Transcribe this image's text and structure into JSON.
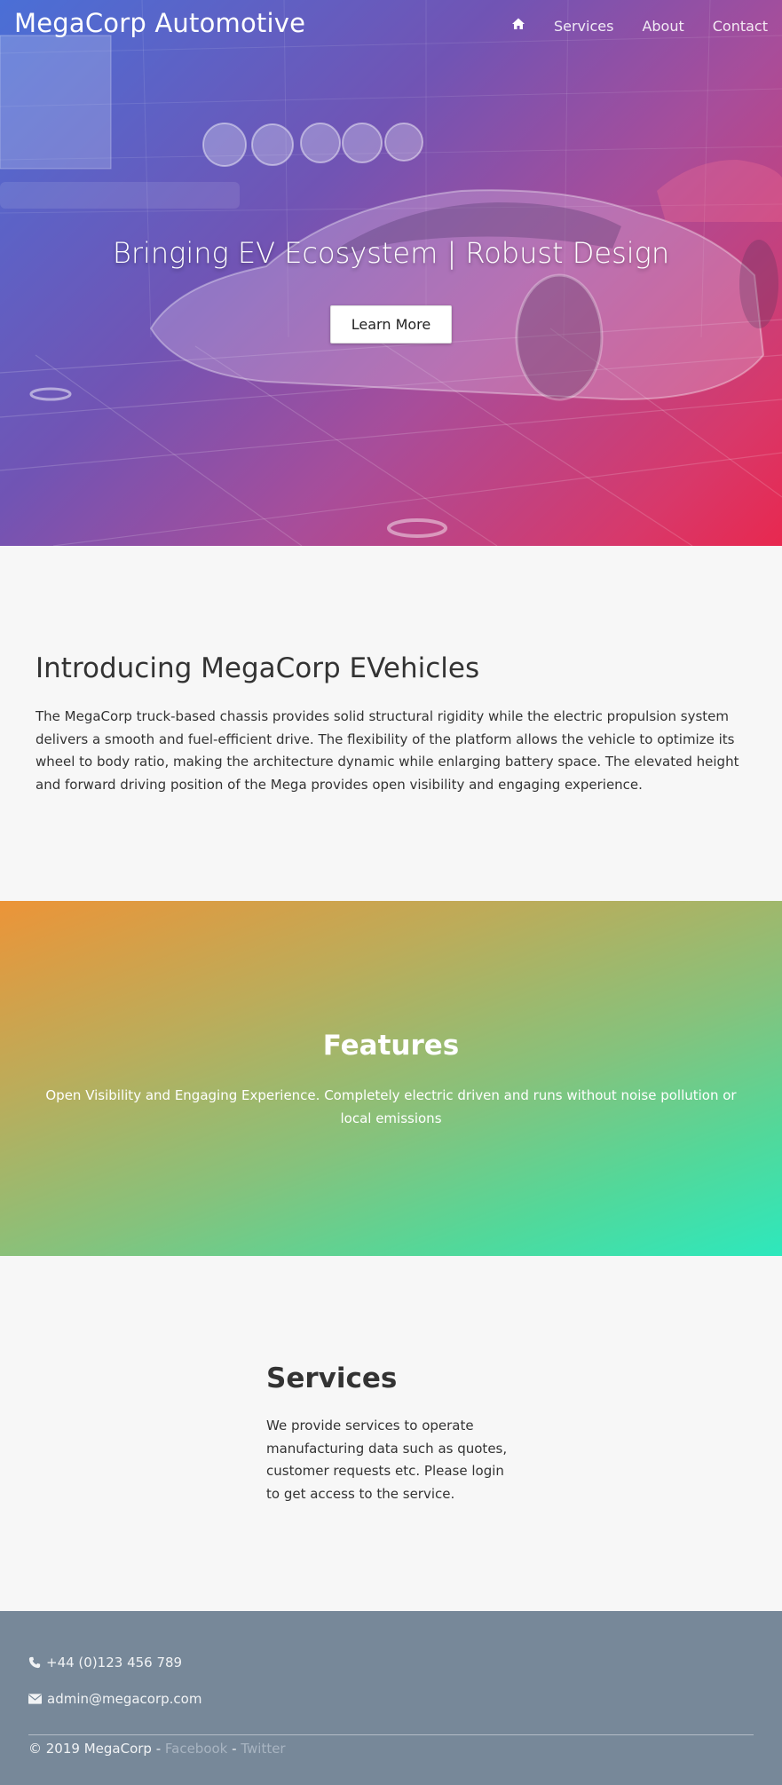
{
  "nav": {
    "brand": "MegaCorp Automotive",
    "home_icon": "home-icon",
    "links": [
      "Services",
      "About",
      "Contact"
    ]
  },
  "hero": {
    "title": "Bringing EV Ecosystem | Robust Design",
    "button_label": "Learn More",
    "gradient": [
      "#4a6fd6",
      "#a84d9a",
      "#e8284f"
    ]
  },
  "intro": {
    "title": "Introducing MegaCorp EVehicles",
    "text": "The MegaCorp truck-based chassis provides solid structural rigidity while the electric propulsion system delivers a smooth and fuel-efficient drive. The flexibility of the platform allows the vehicle to optimize its wheel to body ratio, making the architecture dynamic while enlarging battery space. The elevated height and forward driving position of the Mega provides open visibility and engaging experience."
  },
  "features": {
    "title": "Features",
    "text": "Open Visibility and Engaging Experience. Completely electric driven and runs without noise pollution or local emissions",
    "gradient": [
      "#ec9438",
      "#2de8bd"
    ]
  },
  "services": {
    "title": "Services",
    "text": "We provide services to operate manufacturing data such as quotes, customer requests etc. Please login to get access to the service."
  },
  "footer": {
    "phone": "+44 (0)123 456 789",
    "email": "admin@megacorp.com",
    "copyright": "© 2019 MegaCorp - ",
    "separator": " - ",
    "facebook": "Facebook",
    "twitter": "Twitter",
    "background": "#778899"
  }
}
